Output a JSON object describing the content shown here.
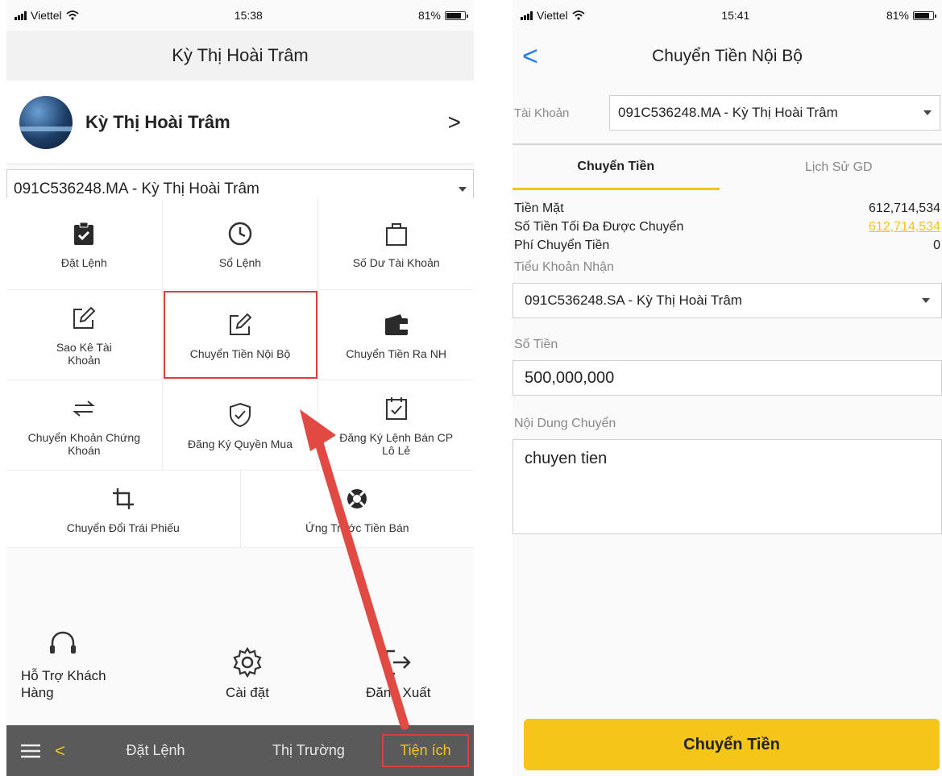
{
  "left": {
    "status": {
      "carrier": "Viettel",
      "time": "15:38",
      "battery": "81%"
    },
    "title": "Kỳ Thị Hoài Trâm",
    "profile": {
      "name": "Kỳ Thị Hoài Trâm"
    },
    "account": "091C536248.MA - Kỳ Thị Hoài Trâm",
    "menu": [
      {
        "label": "Đặt Lệnh",
        "icon": "clipboard-check-icon"
      },
      {
        "label": "Sổ Lệnh",
        "icon": "clock-icon"
      },
      {
        "label": "Số Dư Tài Khoản",
        "icon": "shopping-bag-icon"
      },
      {
        "label": "Sao Kê Tài Khoản",
        "icon": "edit-icon"
      },
      {
        "label": "Chuyển Tiền Nội Bộ",
        "icon": "edit-icon"
      },
      {
        "label": "Chuyển Tiền Ra NH",
        "icon": "wallet-icon"
      },
      {
        "label": "Chuyển Khoản Chứng Khoán",
        "icon": "swap-icon"
      },
      {
        "label": "Đăng Ký Quyền Mua",
        "icon": "shield-check-icon"
      },
      {
        "label": "Đăng Ký Lệnh Bán CP Lô Lẻ",
        "icon": "calendar-check-icon"
      },
      {
        "label": "Chuyển Đổi Trái Phiếu",
        "icon": "crop-icon"
      },
      {
        "label": "Ứng Trước Tiền Bán",
        "icon": "lifebuoy-icon"
      }
    ],
    "support": [
      {
        "label": "Hỗ Trợ Khách Hàng",
        "icon": "headset-icon"
      },
      {
        "label": "Cài đặt",
        "icon": "gear-icon"
      },
      {
        "label": "Đăng Xuất",
        "icon": "logout-icon"
      }
    ],
    "bottom_nav": {
      "tab1": "Đặt Lệnh",
      "tab2": "Thị Trường",
      "tab3": "Tiện ích"
    }
  },
  "right": {
    "status": {
      "carrier": "Viettel",
      "time": "15:41",
      "battery": "81%"
    },
    "title": "Chuyển Tiền Nội Bộ",
    "account_label": "Tài Khoản",
    "account_value": "091C536248.MA - Kỳ Thị Hoài Trâm",
    "tabs": {
      "active": "Chuyển Tiền",
      "other": "Lịch Sử GD"
    },
    "info": [
      {
        "label": "Tiền Mặt",
        "value": "612,714,534"
      },
      {
        "label": "Số Tiền Tối Đa Được Chuyển",
        "value": "612,714,534"
      },
      {
        "label": "Phí Chuyển Tiền",
        "value": "0"
      }
    ],
    "receive_label": "Tiểu Khoản Nhận",
    "receive_value": "091C536248.SA - Kỳ Thị Hoài Trâm",
    "amount_label": "Số Tiền",
    "amount_value": "500,000,000",
    "content_label": "Nội Dung Chuyển",
    "content_value": "chuyen tien",
    "submit_label": "Chuyển Tiền"
  },
  "colors": {
    "accent": "#f5c518",
    "highlight": "#d9403a",
    "link_blue": "#1e7cf0"
  }
}
